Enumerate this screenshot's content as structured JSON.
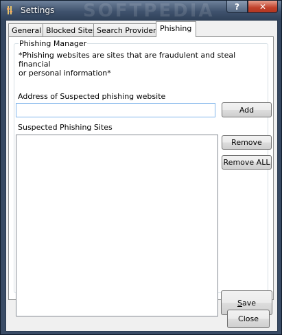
{
  "window": {
    "title": "Settings",
    "watermark": "SOFTPEDIA",
    "help_label": "?",
    "close_label": "✕"
  },
  "tabs": [
    "General",
    "Blocked Sites",
    "Search Providers",
    "Phishing"
  ],
  "phishing": {
    "group_title": "Phishing Manager",
    "note_line1": "*Phishing websites are sites that are fraudulent and steal financial",
    "note_line2": "or personal information*",
    "address_label": "Address of Suspected phishing website",
    "address_value": "",
    "add_label": "Add",
    "list_label": "Suspected Phishing Sites",
    "sites": [],
    "remove_label": "Remove",
    "remove_all_label": "Remove ALL",
    "save_label_first": "S",
    "save_label_rest": "ave"
  },
  "footer": {
    "close_label": "Close"
  },
  "colors": {
    "input_border": "#7eb4ea",
    "close_button": "#c0412b"
  }
}
